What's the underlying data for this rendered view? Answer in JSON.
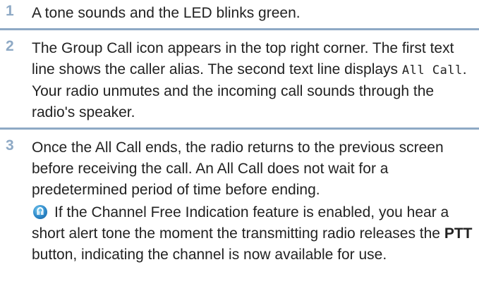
{
  "steps": [
    {
      "number": "1",
      "text": "A tone sounds and the LED blinks green."
    },
    {
      "number": "2",
      "text_before": "The Group Call icon appears in the top right corner. The first text line shows the caller alias. The second text line displays ",
      "display_text": "All Call",
      "text_after": ". Your radio unmutes and the incoming call sounds through the radio's speaker."
    },
    {
      "number": "3",
      "text": "Once the All Call ends, the radio returns to the previous screen before receiving the call. An All Call does not wait for a predetermined period of time before ending."
    }
  ],
  "note": {
    "icon": "radio-feature-icon",
    "text_before": "If the Channel Free Indication feature is enabled, you hear a short alert tone the moment the transmitting radio releases the ",
    "bold": "PTT",
    "text_after": " button, indicating the channel is now available for use."
  },
  "colors": {
    "accent": "#8ea9c5",
    "text": "#222222"
  }
}
